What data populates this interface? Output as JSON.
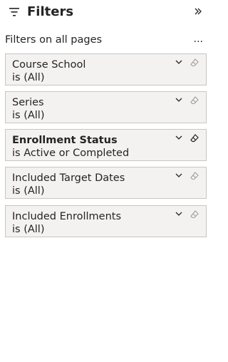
{
  "header": {
    "title": "Filters"
  },
  "section": {
    "label": "Filters on all pages",
    "more": "..."
  },
  "filters": [
    {
      "name": "Course School",
      "condition": "is (All)",
      "active": false
    },
    {
      "name": "Series",
      "condition": "is (All)",
      "active": false
    },
    {
      "name": "Enrollment Status",
      "condition": "is Active or Completed",
      "active": true
    },
    {
      "name": "Included Target Dates",
      "condition": "is (All)",
      "active": false
    },
    {
      "name": "Included Enrollments",
      "condition": "is (All)",
      "active": false
    }
  ]
}
